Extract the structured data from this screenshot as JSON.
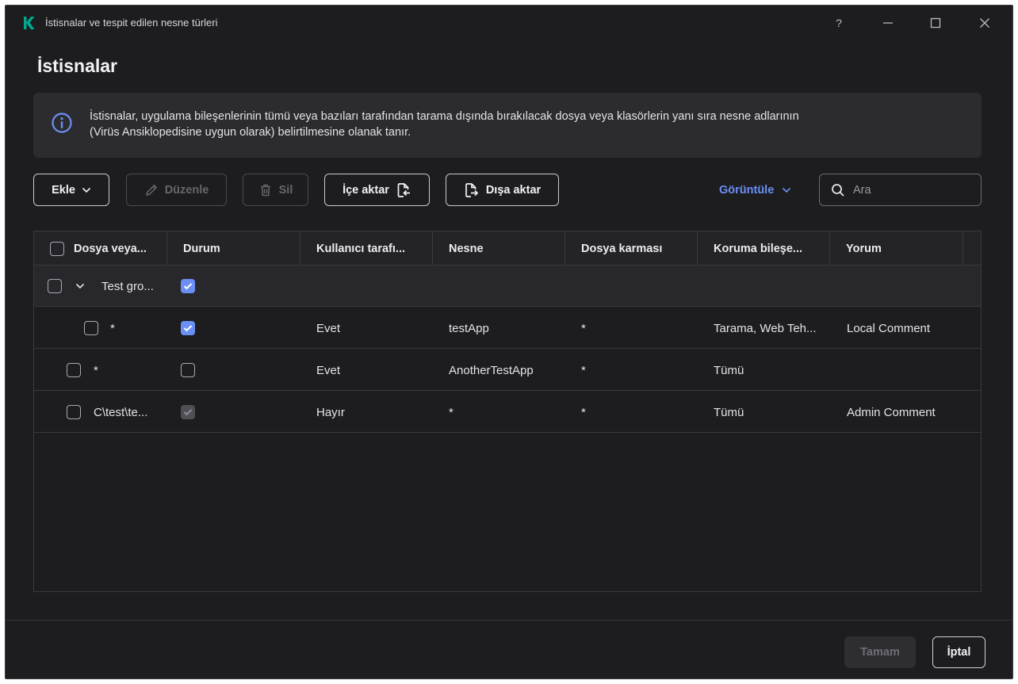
{
  "window": {
    "title": "İstisnalar ve tespit edilen nesne türleri",
    "help_glyph": "?",
    "minimize_glyph": "—",
    "maximize_glyph": "☐",
    "close_glyph": "✕"
  },
  "page_title": "İstisnalar",
  "info": {
    "icon": "info-icon",
    "text_line1": "İstisnalar, uygulama bileşenlerinin tümü veya bazıları tarafından tarama dışında bırakılacak dosya veya klasörlerin yanı sıra nesne adlarının",
    "text_line2": "(Virüs Ansiklopedisine uygun olarak) belirtilmesine olanak tanır."
  },
  "toolbar": {
    "add_label": "Ekle",
    "edit_label": "Düzenle",
    "delete_label": "Sil",
    "import_label": "İçe aktar",
    "export_label": "Dışa aktar",
    "view_label": "Görüntüle",
    "search_placeholder": "Ara"
  },
  "table": {
    "columns": [
      "Dosya veya...",
      "Durum",
      "Kullanıcı tarafı...",
      "Nesne",
      "Dosya karması",
      "Koruma bileşe...",
      "Yorum"
    ],
    "rows": [
      {
        "kind": "group",
        "name": "Test gro...",
        "status": "checked",
        "user": "",
        "object": "",
        "hash": "",
        "components": "",
        "comment": ""
      },
      {
        "kind": "child",
        "name": "*",
        "status": "checked",
        "user": "Evet",
        "object": "testApp",
        "hash": "*",
        "components": "Tarama, Web Teh...",
        "comment": "Local Comment"
      },
      {
        "kind": "item",
        "name": "*",
        "status": "unchecked",
        "user": "Evet",
        "object": "AnotherTestApp",
        "hash": "*",
        "components": "Tümü",
        "comment": ""
      },
      {
        "kind": "item",
        "name": "C\\test\\te...",
        "status": "checked-disabled",
        "user": "Hayır",
        "object": "*",
        "hash": "*",
        "components": "Tümü",
        "comment": "Admin Comment"
      }
    ]
  },
  "footer": {
    "ok_label": "Tamam",
    "cancel_label": "İptal"
  },
  "colors": {
    "accent": "#6b8ff5",
    "logo": "#00a88e",
    "background": "#1d1d20"
  }
}
